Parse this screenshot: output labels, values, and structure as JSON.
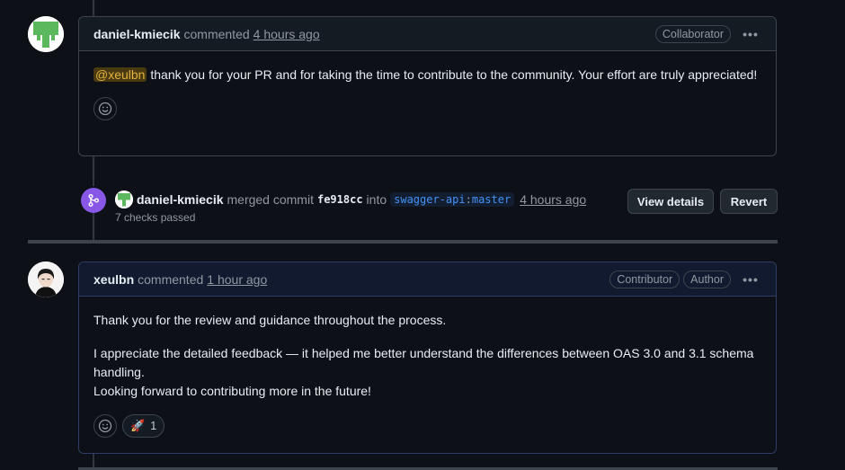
{
  "comment1": {
    "author": "daniel-kmiecik",
    "action": "commented",
    "time": "4 hours ago",
    "badge": "Collaborator",
    "mention": "@xeulbn",
    "body_rest": " thank you for your PR and for taking the time to contribute to the community. Your effort are truly appreciated!"
  },
  "merge": {
    "author": "daniel-kmiecik",
    "action": "merged commit",
    "sha": "fe918cc",
    "into": "into",
    "branch_owner": "swagger-api",
    "branch_sep": ":",
    "branch_name": "master",
    "time": "4 hours ago",
    "checks": "7 checks passed",
    "view_details_label": "View details",
    "revert_label": "Revert"
  },
  "comment2": {
    "author": "xeulbn",
    "action": "commented",
    "time": "1 hour ago",
    "badges": [
      "Contributor",
      "Author"
    ],
    "paragraph1": "Thank you for the review and guidance throughout the process.",
    "paragraph2_line1": "I appreciate the detailed feedback — it helped me better understand the differences between OAS 3.0 and 3.1 schema handling.",
    "paragraph2_line2": "Looking forward to contributing more in the future!",
    "reaction": {
      "emoji": "🚀",
      "count": "1"
    }
  },
  "colors": {
    "background": "#0d1117",
    "merge_purple": "#8957e5",
    "mention_bg": "#4a3a10",
    "branch_blue": "#4493f8",
    "identicon_green": "#5cb85c"
  },
  "icons": {
    "kebab": "kebab-horizontal-icon",
    "smiley": "smiley-icon",
    "merge": "git-merge-icon"
  }
}
